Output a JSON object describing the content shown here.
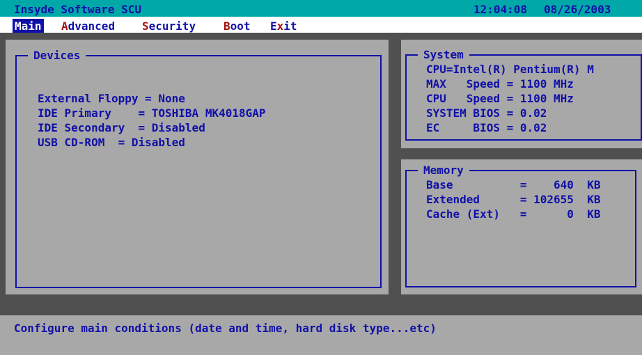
{
  "title_bar": {
    "app_title": "Insyde Software SCU",
    "time": "12:04:08",
    "date": "08/26/2003"
  },
  "menu": {
    "items": [
      {
        "label": "Main",
        "hotkey": "M",
        "rest": "ain",
        "active": true
      },
      {
        "label": "Advanced",
        "hotkey": "A",
        "rest": "dvanced",
        "active": false
      },
      {
        "label": "Security",
        "hotkey": "S",
        "rest": "ecurity",
        "active": false
      },
      {
        "label": "Boot",
        "hotkey": "B",
        "rest": "oot",
        "active": false
      },
      {
        "label": "Exit",
        "pre": "E",
        "hotkey": "x",
        "rest": "it",
        "active": false
      }
    ]
  },
  "devices_panel": {
    "title": "Devices",
    "lines": [
      "External Floppy = None",
      "IDE Primary    = TOSHIBA MK4018GAP",
      "IDE Secondary  = Disabled",
      "USB CD-ROM  = Disabled"
    ]
  },
  "system_panel": {
    "title": "System",
    "lines": [
      "CPU=Intel(R) Pentium(R) M",
      "MAX   Speed = 1100 MHz",
      "CPU   Speed = 1100 MHz",
      "SYSTEM BIOS = 0.02",
      "EC     BIOS = 0.02"
    ]
  },
  "memory_panel": {
    "title": "Memory",
    "lines": [
      "Base          =    640  KB",
      "Extended      = 102655  KB",
      "Cache (Ext)   =      0  KB"
    ]
  },
  "status": {
    "help_text": "Configure main conditions (date and time, hard disk type...etc)"
  },
  "colors": {
    "background": "#a8a8a8",
    "title_bar": "#00a8a8",
    "text": "#1010a8",
    "hotkey": "#a81010",
    "workspace": "#505050"
  }
}
